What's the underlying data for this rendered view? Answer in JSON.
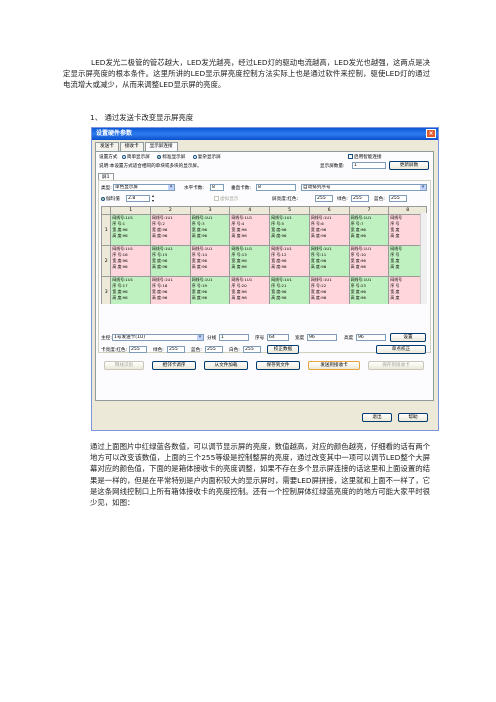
{
  "doc": {
    "p1": "LED发光二极管的管芯越大，LED发光越亮，经过LED灯的驱动电流越高，LED发光也越强，这两点是决定显示屏亮度的根本条件。这里所讲的LED显示屏亮度控制方法实际上也是通过软件来控制，驱使LED灯的通过电流增大或减少，从而来调整LED显示屏的亮度。",
    "h1": "1、 通过发送卡改变显示屏亮度",
    "p2": "通过上面图片中红绿蓝各数值，可以调节显示屏的亮度，数值越高，对应的颜色越亮，仔细看的话有两个地方可以改变该数值，上面的三个255等级是控制整屏的亮度，通过改变其中一项可以调节LED整个大屏幕对应的颜色值，下面的是箱体接收卡的亮度调整，如果不存在多个显示屏连接的话这里和上面设置的结果是一样的，但是在平常特别是户内面积较大的显示屏时，需要LED屏拼接，这里就和上面不一样了，它是这条网线控制口上所有箱体接收卡的亮度控制。还有一个控制屏体红绿蓝亮度的的地方可能大家平时很少见，如图："
  },
  "win": {
    "title": "设置硬件参数",
    "close": "×",
    "tabs": [
      "发送卡",
      "接收卡",
      "显示屏连接"
    ],
    "set_mode_label": "设置方式",
    "modes": [
      "简单显示屏",
      "标准显示屏",
      "复杂显示屏"
    ],
    "smart_label": "启用智能连接",
    "desc": "说明:本设置方式适合相同的单块或多块的显示屏。",
    "screen_count_label": "显示屏数量:",
    "screen_count": "1",
    "update_btn": "更新屏数",
    "screen_tab": "屏1",
    "type_label": "类型:",
    "type_value": "单色显示屏",
    "hcards_label": "水平卡数:",
    "hcards": "8",
    "vcards_label": "垂直卡数:",
    "vcards": "8",
    "arrange_value": "自动排列序号",
    "gamma_label": "伽玛值",
    "gamma_value": "2.8",
    "virtual_label": "虚拟显示",
    "bright_red_label": "屏亮度:红色:",
    "bright_red": "255",
    "green_label": "绿色:",
    "bright_green": "255",
    "blue_label": "蓝色:",
    "bright_blue": "255",
    "col_headers": [
      "1",
      "2",
      "3",
      "4",
      "5",
      "6",
      "7",
      "8"
    ],
    "rows": [
      {
        "n": "1",
        "cells": [
          [
            "网线号:1U1",
            "序 号:1",
            "宽 度:96",
            "高 度:96"
          ],
          [
            "网线号:1U1",
            "序 号:2",
            "宽 度:96",
            "高 度:96"
          ],
          [
            "网线号:1U1",
            "序 号:3",
            "宽 度:96",
            "高 度:96"
          ],
          [
            "网线号:1U1",
            "序 号:4",
            "宽 度:96",
            "高 度:96"
          ],
          [
            "网线号:1U1",
            "序 号:5",
            "宽 度:96",
            "高 度:96"
          ],
          [
            "网线号:1U1",
            "序 号:6",
            "宽 度:96",
            "高 度:96"
          ],
          [
            "网线号:1U1",
            "序 号:7",
            "宽 度:96",
            "高 度:96"
          ],
          [
            "网线号",
            "序 号",
            "宽 度",
            "高 度"
          ]
        ]
      },
      {
        "n": "2",
        "cells": [
          [
            "网线号:1U1",
            "序 号:16",
            "宽 度:96",
            "高 度:96"
          ],
          [
            "网线号:1U1",
            "序 号:15",
            "宽 度:96",
            "高 度:96"
          ],
          [
            "网线号:1U1",
            "序 号:14",
            "宽 度:96",
            "高 度:96"
          ],
          [
            "网线号:1U1",
            "序 号:13",
            "宽 度:96",
            "高 度:96"
          ],
          [
            "网线号:1U1",
            "序 号:12",
            "宽 度:96",
            "高 度:96"
          ],
          [
            "网线号:1U1",
            "序 号:11",
            "宽 度:96",
            "高 度:96"
          ],
          [
            "网线号:1U1",
            "序 号:10",
            "宽 度:96",
            "高 度:96"
          ],
          [
            "网线号",
            "序 号",
            "宽 度",
            "高 度"
          ]
        ]
      },
      {
        "n": "3",
        "cells": [
          [
            "网线号:1U1",
            "序 号:17",
            "宽 度:96",
            "高 度:96"
          ],
          [
            "网线号:1U1",
            "序 号:18",
            "宽 度:96",
            "高 度:96"
          ],
          [
            "网线号:1U1",
            "序 号:19",
            "宽 度:96",
            "高 度:96"
          ],
          [
            "网线号:1U1",
            "序 号:20",
            "宽 度:96",
            "高 度:96"
          ],
          [
            "网线号:1U1",
            "序 号:21",
            "宽 度:96",
            "高 度:96"
          ],
          [
            "网线号:1U1",
            "序 号:22",
            "宽 度:96",
            "高 度:96"
          ],
          [
            "网线号:1U1",
            "序 号:23",
            "宽 度:96",
            "高 度:96"
          ],
          [
            "网线号",
            "序 号",
            "宽 度",
            "高 度"
          ]
        ]
      }
    ],
    "row_colors": [
      [
        "green",
        "pink",
        "green",
        "pink",
        "green",
        "pink",
        "green",
        "pink"
      ],
      [
        "pink",
        "green",
        "pink",
        "green",
        "pink",
        "green",
        "pink",
        "green"
      ],
      [
        "green",
        "pink",
        "green",
        "pink",
        "green",
        "pink",
        "green",
        "pink"
      ]
    ],
    "master_label": "主控:",
    "master_value": "1号发送卡(1U)",
    "split_label": "分线",
    "split_value": "1",
    "seq_label": "序号",
    "seq_value": "64",
    "width_label": "宽度",
    "width_value": "96",
    "height_label": "高度",
    "height_value": "96",
    "set_btn": "设置",
    "card_bright_label": "卡亮度:红色:",
    "card_red": "255",
    "card_green_label": "绿色:",
    "card_green": "255",
    "card_blue_label": "蓝色:",
    "card_blue": "255",
    "white_label": "白色:",
    "white_value": "255",
    "calib_btn": "校正数据",
    "single_calib_btn": "单点校正",
    "bottom_btns": [
      "网线识别",
      "相邻卡调序",
      "从文件加载",
      "保存到文件",
      "发送到接收卡",
      "保存到接收卡"
    ],
    "exit_btn": "退出",
    "help_btn": "帮助"
  }
}
